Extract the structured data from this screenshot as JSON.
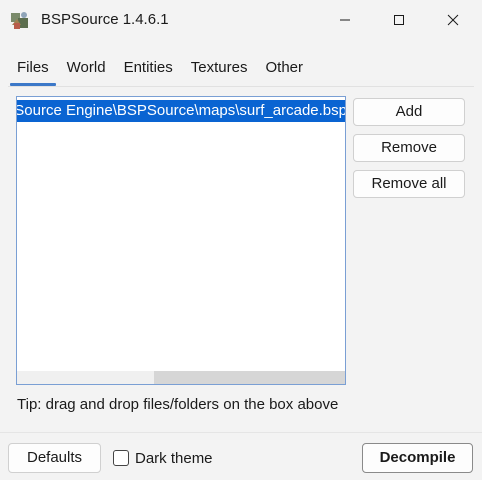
{
  "window": {
    "title": "BSPSource 1.4.6.1",
    "app_icon": "bspsource-app-icon",
    "controls": {
      "minimize_icon": "minimize-icon",
      "maximize_icon": "maximize-icon",
      "close_icon": "close-icon"
    }
  },
  "tabs": [
    {
      "label": "Files",
      "active": true
    },
    {
      "label": "World",
      "active": false
    },
    {
      "label": "Entities",
      "active": false
    },
    {
      "label": "Textures",
      "active": false
    },
    {
      "label": "Other",
      "active": false
    }
  ],
  "file_list": {
    "items": [
      {
        "path": "Source Engine\\BSPSource\\maps\\surf_arcade.bsp",
        "selected": true
      }
    ]
  },
  "side_buttons": {
    "add": "Add",
    "remove": "Remove",
    "remove_all": "Remove all"
  },
  "tip": "Tip: drag and drop files/folders on the box above",
  "footer": {
    "defaults": "Defaults",
    "dark_theme_label": "Dark theme",
    "dark_theme_checked": false,
    "decompile": "Decompile"
  },
  "colors": {
    "accent": "#3c78c8",
    "selection": "#0a64d2",
    "background": "#f3f3f3"
  }
}
